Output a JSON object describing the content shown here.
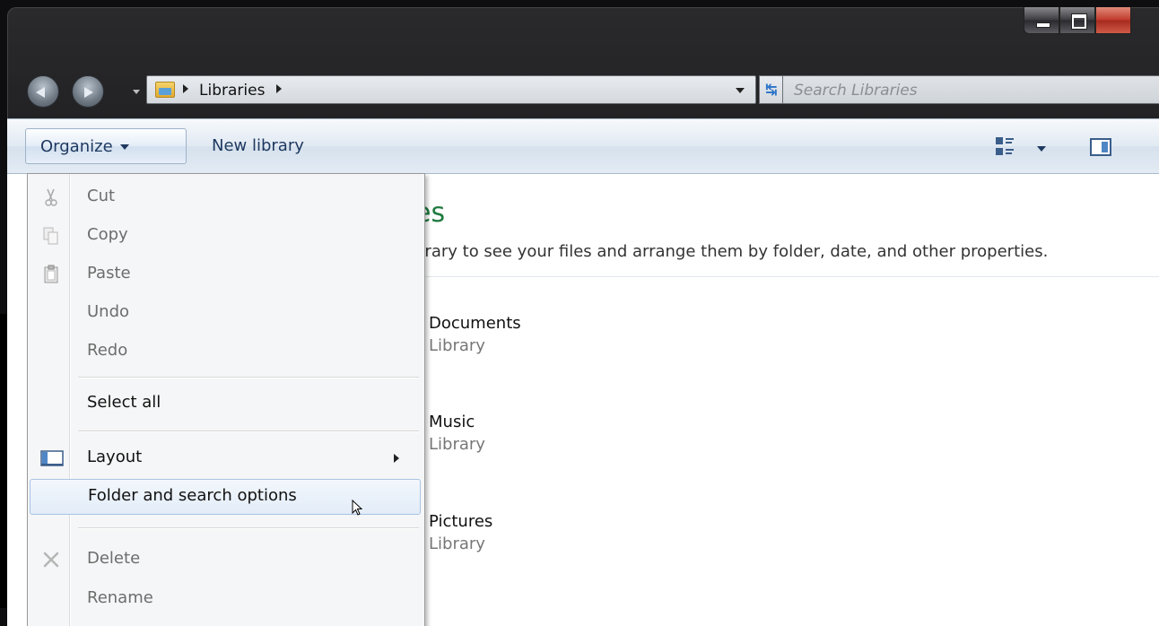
{
  "address": {
    "crumb": "Libraries"
  },
  "search": {
    "placeholder": "Search Libraries"
  },
  "toolbar": {
    "organize_label": "Organize",
    "new_library_label": "New library"
  },
  "content": {
    "title_partial": "es",
    "description_partial": "brary to see your files and arrange them by folder, date, and other properties.",
    "items": [
      {
        "name": "Documents",
        "type": "Library"
      },
      {
        "name": "Music",
        "type": "Library"
      },
      {
        "name": "Pictures",
        "type": "Library"
      }
    ]
  },
  "menu": {
    "items": [
      {
        "label": "Cut",
        "icon": "scissors-icon",
        "enabled": false
      },
      {
        "label": "Copy",
        "icon": "copy-icon",
        "enabled": false
      },
      {
        "label": "Paste",
        "icon": "clipboard-icon",
        "enabled": false
      },
      {
        "label": "Undo",
        "enabled": false
      },
      {
        "label": "Redo",
        "enabled": false
      },
      {
        "label": "Select all",
        "enabled": true
      },
      {
        "label": "Layout",
        "icon": "layout-icon",
        "enabled": true,
        "submenu": true
      },
      {
        "label": "Folder and search options",
        "enabled": true,
        "highlighted": true
      },
      {
        "label": "Delete",
        "icon": "delete-icon",
        "enabled": false
      },
      {
        "label": "Rename",
        "enabled": false
      }
    ]
  },
  "colors": {
    "title_green": "#1f7a3f",
    "toolbar_text": "#1e3960",
    "highlight_border": "#a9c4e4"
  }
}
